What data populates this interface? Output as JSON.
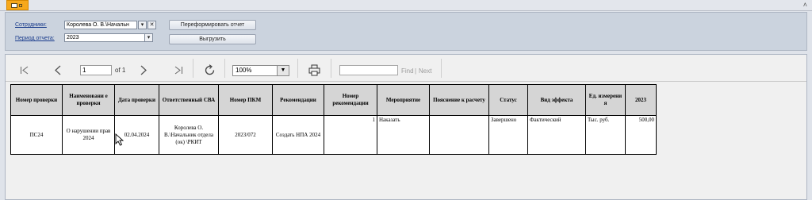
{
  "params": {
    "employee_label": "Сотрудники:",
    "employee_value": "Королева О. В.\\Начальн",
    "period_label": "Период отчета:",
    "period_value": "2023",
    "reform_button": "Переформировать отчет",
    "export_button": "Выгрузить"
  },
  "toolbar": {
    "page_value": "1",
    "page_of": "of 1",
    "zoom_value": "100%",
    "find_label": "Find",
    "find_separator": "|",
    "next_label": "Next"
  },
  "table": {
    "columns": [
      "Номер проверки",
      "Наименовани е проверки",
      "Дата проверки",
      "Ответственный СВА",
      "Номер ПКМ",
      "Рекомендации",
      "Номер рекомендации",
      "Мероприятие",
      "Пояснение к расчету",
      "Статус",
      "Вид эффекта",
      "Ед. измерени я",
      "2023"
    ],
    "rows": [
      [
        "ПС24",
        "О нарушении прав 2024",
        "02.04.2024",
        "Королева О. В.\\Начальник отдела (ок) \\РКИТ",
        "2023/072",
        "Создать НПА 2024",
        "1",
        "Наказать",
        "",
        "Завершено",
        "Фактический",
        "Тыс. руб.",
        "500,00"
      ]
    ]
  }
}
